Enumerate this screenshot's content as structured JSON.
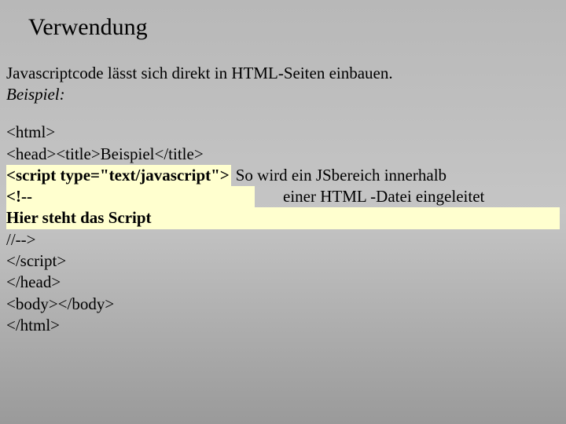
{
  "title": "Verwendung",
  "intro": "Javascriptcode lässt sich direkt in HTML-Seiten einbauen.",
  "intro_label": "Beispiel:",
  "code": {
    "l1": "<html>",
    "l2": "<head><title>Beispiel</title>",
    "script_open": "<script type=\"text/javascript\">",
    "annot1": "So wird ein JSbereich innerhalb",
    "comment_open": "<!--",
    "annot2": "einer HTML -Datei eingeleitet",
    "script_body": "Hier steht das Script",
    "comment_close": "//-->",
    "script_close": "</script>",
    "l_head_close": "</head>",
    "l_body": "<body></body>",
    "l_html_close": "</html>"
  }
}
